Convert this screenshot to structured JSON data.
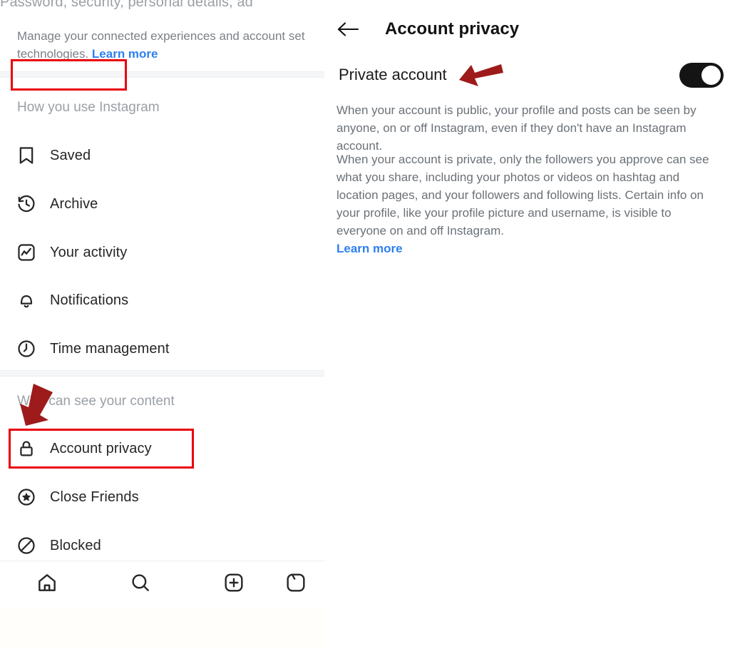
{
  "left_panel": {
    "cut_off_header": "Password, security, personal details, ad",
    "blurb_line1": "Manage your connected experiences and account set",
    "blurb_line2_prefix": "technologies. ",
    "blurb_learn_more": "Learn more",
    "section_how": "How you use Instagram",
    "section_who": "Who can see your content",
    "items_how": [
      {
        "label": "Saved",
        "icon": "bookmark-icon"
      },
      {
        "label": "Archive",
        "icon": "archive-clock-icon"
      },
      {
        "label": "Your activity",
        "icon": "activity-chart-icon"
      },
      {
        "label": "Notifications",
        "icon": "bell-icon"
      },
      {
        "label": "Time management",
        "icon": "clock-icon"
      }
    ],
    "items_who": [
      {
        "label": "Account privacy",
        "icon": "lock-icon"
      },
      {
        "label": "Close Friends",
        "icon": "star-circle-icon"
      },
      {
        "label": "Blocked",
        "icon": "blocked-icon"
      }
    ],
    "bottom_nav": [
      {
        "icon": "home-icon"
      },
      {
        "icon": "search-icon"
      },
      {
        "icon": "add-post-icon"
      },
      {
        "icon": "reels-icon-partial"
      }
    ]
  },
  "right_panel": {
    "back_icon": "back-arrow-icon",
    "title": "Account privacy",
    "private_account_label": "Private account",
    "toggle_state": "on",
    "paragraph_public": "When your account is public, your profile and posts can be seen by anyone, on or off Instagram, even if they don't have an Instagram account.",
    "paragraph_private": "When your account is private, only the followers you approve can see what you share, including your photos or videos on hashtag and location pages, and your followers and following lists. Certain info on your profile, like your profile picture and username, is visible to everyone on and off Instagram.",
    "learn_more": "Learn more"
  },
  "annotations": {
    "highlight_color": "#e8000d",
    "arrow_color": "#9e1b1b",
    "boxed_items": [
      "Private account",
      "Account privacy"
    ],
    "arrows": [
      "points-to-private-account",
      "points-to-account-privacy"
    ]
  },
  "colors": {
    "link": "#2d7ff0",
    "muted_text": "#7b8087",
    "primary_text": "#262626",
    "toggle_on": "#141414",
    "divider": "#f5f6f7"
  }
}
